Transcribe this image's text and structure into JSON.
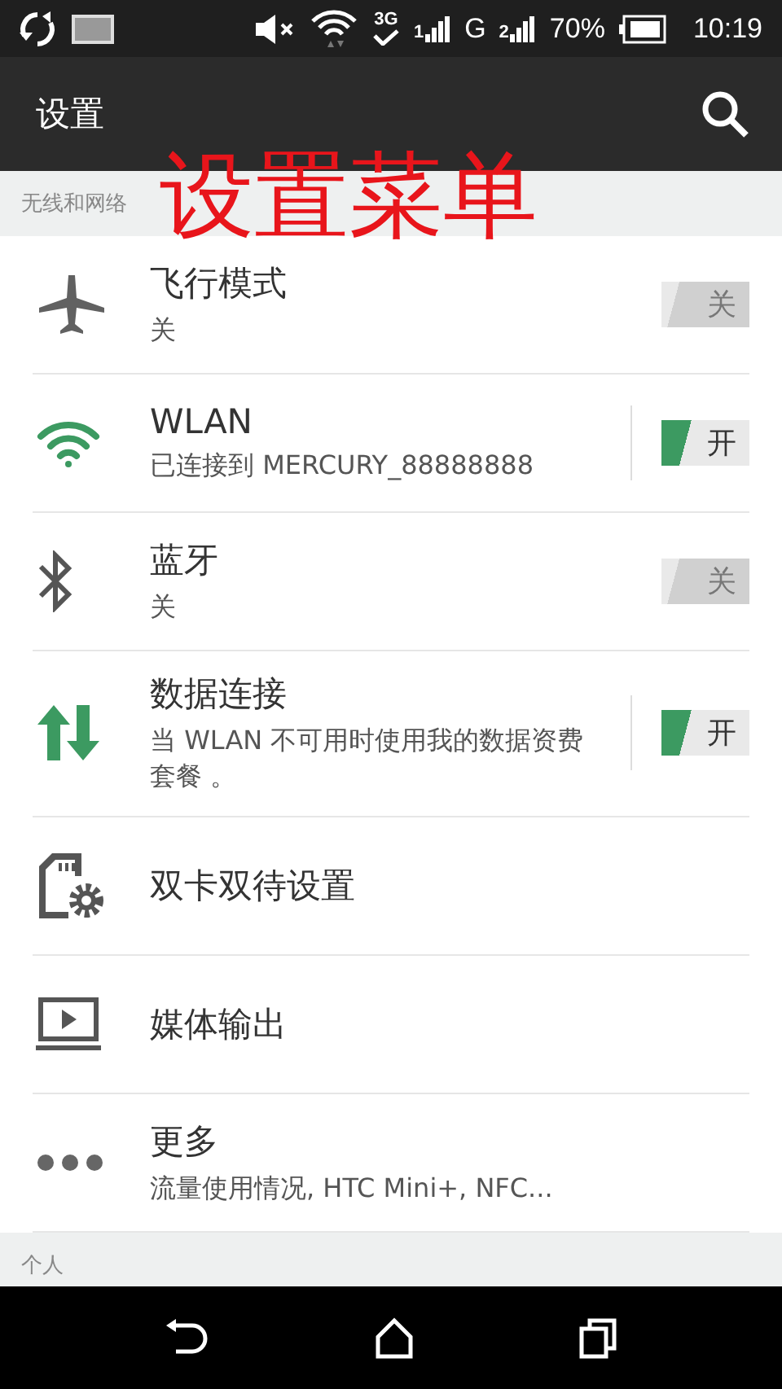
{
  "status_bar": {
    "network_type": "3G",
    "sim1_label": "1",
    "sim2_type": "G",
    "sim2_label": "2",
    "battery_percent": "70%",
    "time": "10:19"
  },
  "app_bar": {
    "title": "设置"
  },
  "annotation": "设置菜单",
  "sections": [
    {
      "header": "无线和网络",
      "items": [
        {
          "kind": "toggle",
          "title": "飞行模式",
          "subtitle": "关",
          "on": false,
          "switch_label": "关",
          "split": false
        },
        {
          "kind": "toggle",
          "title": "WLAN",
          "subtitle": "已连接到 MERCURY_88888888",
          "on": true,
          "switch_label": "开",
          "split": true
        },
        {
          "kind": "toggle",
          "title": "蓝牙",
          "subtitle": "关",
          "on": false,
          "switch_label": "关",
          "split": false
        },
        {
          "kind": "toggle",
          "title": "数据连接",
          "subtitle": "当 WLAN 不可用时使用我的数据资费套餐 。",
          "on": true,
          "switch_label": "开",
          "split": true
        },
        {
          "kind": "plain",
          "title": "双卡双待设置"
        },
        {
          "kind": "plain",
          "title": "媒体输出"
        },
        {
          "kind": "plain",
          "title": "更多",
          "subtitle": "流量使用情况, HTC Mini+, NFC..."
        }
      ]
    },
    {
      "header": "个人"
    }
  ]
}
